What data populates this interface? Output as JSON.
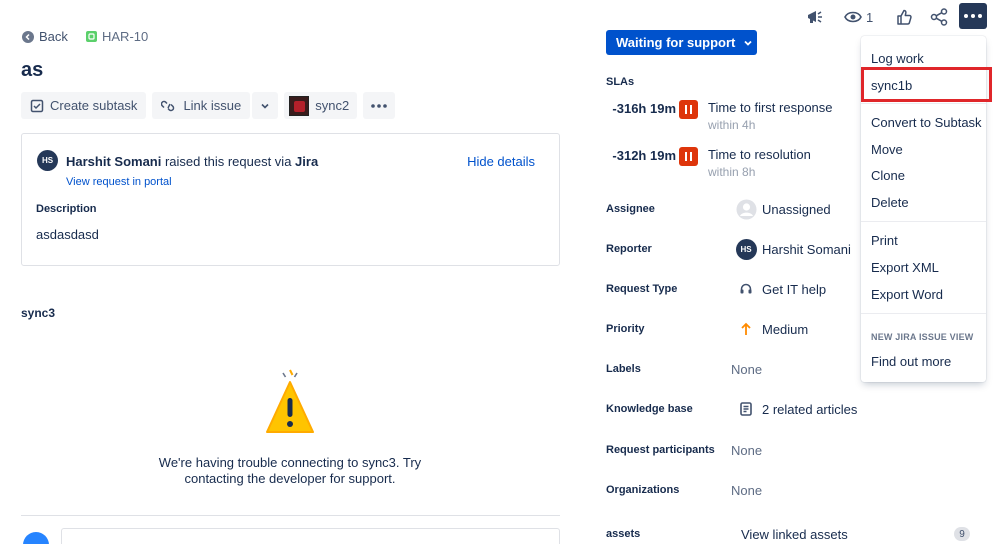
{
  "nav": {
    "back_label": "Back",
    "issue_key": "HAR-10"
  },
  "issue": {
    "title": "as"
  },
  "toolbar": {
    "create_subtask": "Create subtask",
    "link_issue": "Link issue",
    "app_label": "sync2"
  },
  "request": {
    "reporter_initials": "HS",
    "reporter_name": "Harshit Somani",
    "raised_text": " raised this request via ",
    "channel": "Jira",
    "view_portal": "View request in portal",
    "hide_details": "Hide details",
    "description_label": "Description",
    "description_value": "asdasdasd"
  },
  "panel": {
    "title": "sync3",
    "error_line1": "We're having trouble connecting to sync3. Try",
    "error_line2": "contacting the developer for support."
  },
  "header_icons": {
    "watch_count": "1"
  },
  "status": {
    "label": "Waiting for support"
  },
  "slas": {
    "heading": "SLAs",
    "items": [
      {
        "time": "-316h 19m",
        "name": "Time to first response",
        "goal": "within 4h"
      },
      {
        "time": "-312h 19m",
        "name": "Time to resolution",
        "goal": "within 8h"
      }
    ]
  },
  "fields": {
    "assignee": {
      "label": "Assignee",
      "value": "Unassigned"
    },
    "reporter": {
      "label": "Reporter",
      "value": "Harshit Somani",
      "initials": "HS"
    },
    "request_type": {
      "label": "Request Type",
      "value": "Get IT help"
    },
    "priority": {
      "label": "Priority",
      "value": "Medium"
    },
    "labels": {
      "label": "Labels",
      "value": "None"
    },
    "knowledge_base": {
      "label": "Knowledge base",
      "value": "2 related articles"
    },
    "request_participants": {
      "label": "Request participants",
      "value": "None"
    },
    "organizations": {
      "label": "Organizations",
      "value": "None"
    },
    "assets": {
      "label": "assets",
      "value": "View linked assets",
      "count": "9"
    }
  },
  "menu": {
    "items": [
      "Log work",
      "sync1b",
      "Convert to Subtask",
      "Move",
      "Clone",
      "Delete",
      "Print",
      "Export XML",
      "Export Word"
    ],
    "section_heading": "NEW JIRA ISSUE VIEW",
    "find_out_more": "Find out more",
    "highlighted_item": "sync1b"
  },
  "colors": {
    "primary": "#0052cc",
    "text": "#172b4d",
    "sla_breached": "#de350b",
    "priority_medium": "#ff8b00",
    "highlight_outline": "#e0262a"
  }
}
